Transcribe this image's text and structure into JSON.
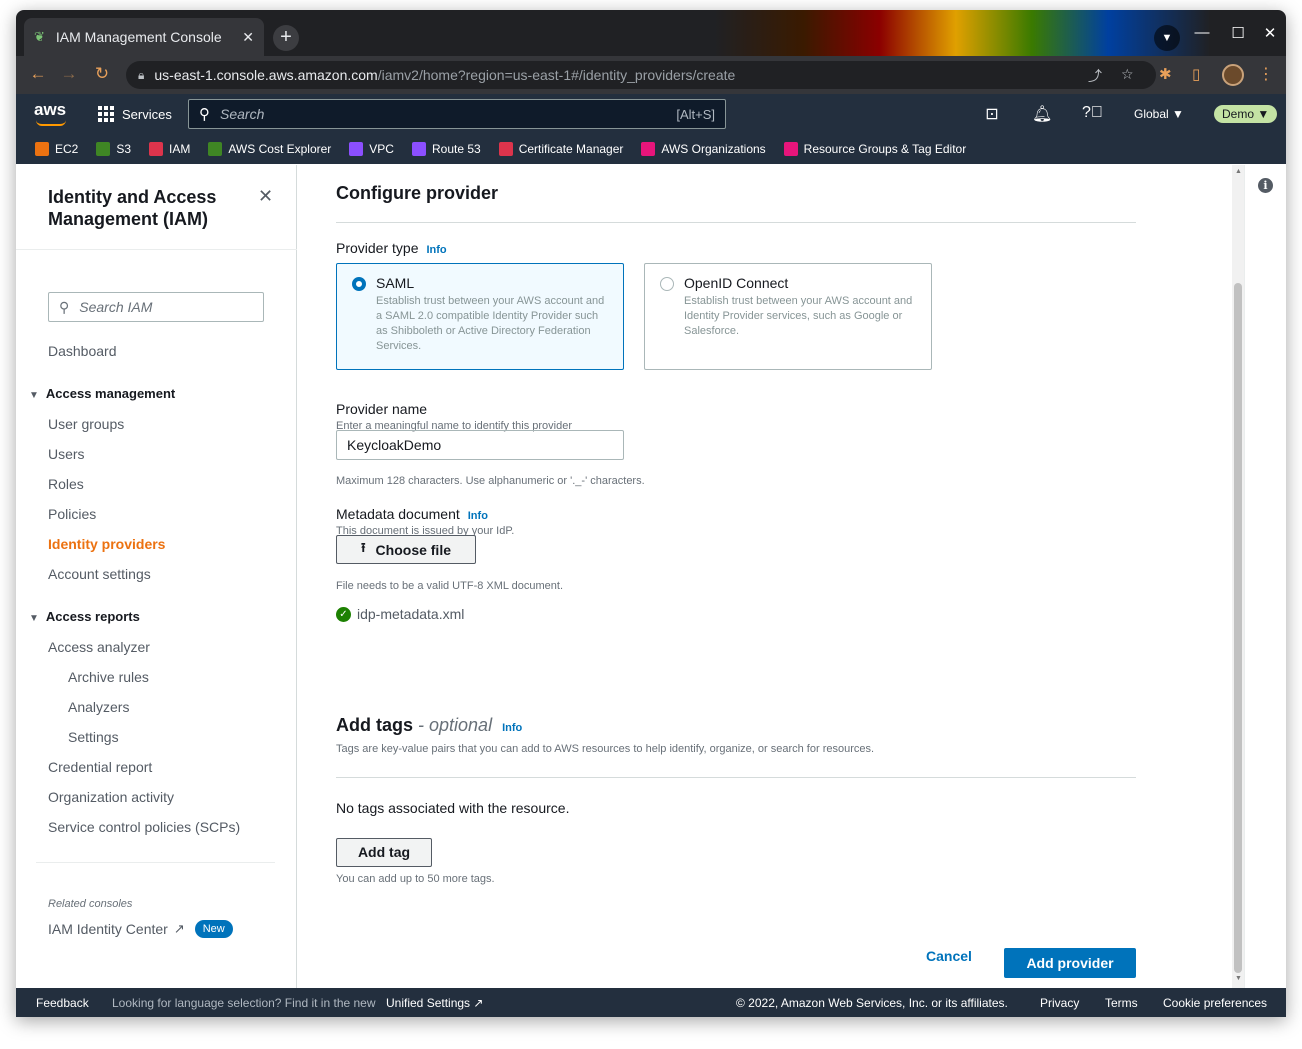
{
  "browser": {
    "tab_title": "IAM Management Console",
    "url_host": "us-east-1.console.aws.amazon.com",
    "url_path": "/iamv2/home?region=us-east-1#/identity_providers/create"
  },
  "aws_nav": {
    "logo": "aws",
    "services_label": "Services",
    "search_placeholder": "Search",
    "search_shortcut": "[Alt+S]",
    "region": "Global ▼",
    "account": "Demo ▼"
  },
  "favorites": [
    {
      "label": "EC2",
      "color": "#ec7211"
    },
    {
      "label": "S3",
      "color": "#3f8624"
    },
    {
      "label": "IAM",
      "color": "#dd344c"
    },
    {
      "label": "AWS Cost Explorer",
      "color": "#3f8624"
    },
    {
      "label": "VPC",
      "color": "#8c4fff"
    },
    {
      "label": "Route 53",
      "color": "#8c4fff"
    },
    {
      "label": "Certificate Manager",
      "color": "#dd344c"
    },
    {
      "label": "AWS Organizations",
      "color": "#e7157b"
    },
    {
      "label": "Resource Groups & Tag Editor",
      "color": "#e7157b"
    }
  ],
  "sidebar": {
    "title": "Identity and Access Management (IAM)",
    "search_placeholder": "Search IAM",
    "dashboard": "Dashboard",
    "access_management": "Access management",
    "user_groups": "User groups",
    "users": "Users",
    "roles": "Roles",
    "policies": "Policies",
    "identity_providers": "Identity providers",
    "account_settings": "Account settings",
    "access_reports": "Access reports",
    "access_analyzer": "Access analyzer",
    "archive_rules": "Archive rules",
    "analyzers": "Analyzers",
    "settings": "Settings",
    "credential_report": "Credential report",
    "organization_activity": "Organization activity",
    "scps": "Service control policies (SCPs)",
    "related_consoles": "Related consoles",
    "identity_center": "IAM Identity Center",
    "new_badge": "New"
  },
  "main": {
    "configure_title": "Configure provider",
    "provider_type_label": "Provider type",
    "info": "Info",
    "saml_title": "SAML",
    "saml_desc": "Establish trust between your AWS account and a SAML 2.0 compatible Identity Provider such as Shibboleth or Active Directory Federation Services.",
    "oidc_title": "OpenID Connect",
    "oidc_desc": "Establish trust between your AWS account and Identity Provider services, such as Google or Salesforce.",
    "provider_name_label": "Provider name",
    "provider_name_hint": "Enter a meaningful name to identify this provider",
    "provider_name_value": "KeycloakDemo",
    "provider_name_constraint": "Maximum 128 characters. Use alphanumeric or '._-' characters.",
    "metadata_label": "Metadata document",
    "metadata_hint": "This document is issued by your IdP.",
    "choose_file": "Choose file",
    "file_constraint": "File needs to be a valid UTF-8 XML document.",
    "file_name": "idp-metadata.xml",
    "tags_title": "Add tags",
    "tags_optional": " - optional",
    "tags_desc": "Tags are key-value pairs that you can add to AWS resources to help identify, organize, or search for resources.",
    "no_tags": "No tags associated with the resource.",
    "add_tag": "Add tag",
    "tags_limit": "You can add up to 50 more tags.",
    "cancel": "Cancel",
    "add_provider": "Add provider"
  },
  "footer": {
    "feedback": "Feedback",
    "language_text": "Looking for language selection? Find it in the new",
    "unified_settings": "Unified Settings",
    "copyright": "© 2022, Amazon Web Services, Inc. or its affiliates.",
    "privacy": "Privacy",
    "terms": "Terms",
    "cookie": "Cookie preferences"
  }
}
